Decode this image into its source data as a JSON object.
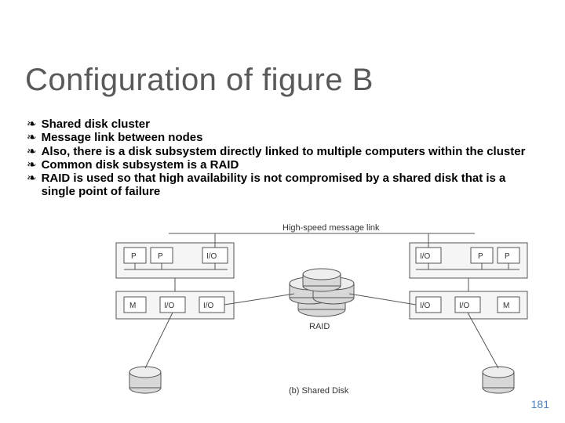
{
  "title": "Configuration of figure B",
  "bullets": {
    "glyph": "❧",
    "items": [
      "Shared disk cluster",
      "Message link between nodes",
      "Also, there is a disk subsystem directly linked to multiple computers within the cluster",
      "Common disk subsystem is a RAID",
      "RAID is used so that high availability is not compromised by a shared disk that is a single point of failure"
    ]
  },
  "diagram": {
    "link_label": "High-speed message link",
    "left_modules": [
      "P",
      "P",
      "I/O"
    ],
    "right_modules": [
      "I/O",
      "P",
      "P"
    ],
    "left_secondary": [
      "M",
      "I/O",
      "I/O"
    ],
    "right_secondary": [
      "I/O",
      "I/O",
      "M"
    ],
    "raid_label": "RAID",
    "caption": "(b) Shared Disk"
  },
  "page_number": "181",
  "decoration": {
    "arc_colors": [
      "#8bdbe5",
      "#a7e4ec",
      "#c3ecf2",
      "#daf3f7"
    ]
  }
}
